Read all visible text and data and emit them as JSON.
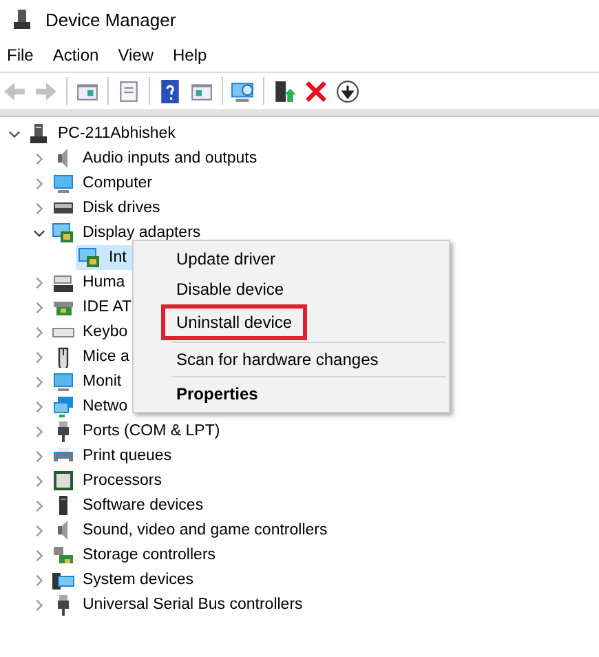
{
  "window": {
    "title": "Device Manager"
  },
  "menu_bar": [
    "File",
    "Action",
    "View",
    "Help"
  ],
  "toolbar": [
    {
      "kind": "back",
      "disabled": true
    },
    {
      "kind": "forward",
      "disabled": true
    },
    {
      "kind": "separator"
    },
    {
      "kind": "tree-pane",
      "disabled": false
    },
    {
      "kind": "separator"
    },
    {
      "kind": "properties",
      "disabled": false
    },
    {
      "kind": "separator"
    },
    {
      "kind": "help",
      "disabled": false
    },
    {
      "kind": "action-pane",
      "disabled": false
    },
    {
      "kind": "separator"
    },
    {
      "kind": "scan",
      "disabled": false
    },
    {
      "kind": "separator"
    },
    {
      "kind": "update",
      "disabled": false
    },
    {
      "kind": "uninstall",
      "disabled": false
    },
    {
      "kind": "disable",
      "disabled": false
    }
  ],
  "tree": {
    "label": "PC-211Abhishek",
    "kind": "pc",
    "expanded": true,
    "children": [
      {
        "label": "Audio inputs and outputs",
        "kind": "speaker",
        "expanded": false
      },
      {
        "label": "Computer",
        "kind": "monitor",
        "expanded": false
      },
      {
        "label": "Disk drives",
        "kind": "disk",
        "expanded": false
      },
      {
        "label": "Display adapters",
        "kind": "adapter",
        "expanded": true,
        "children": [
          {
            "label": "Int",
            "kind": "adapter",
            "selected": true
          }
        ]
      },
      {
        "label": "Huma",
        "kind": "hid",
        "expanded": false
      },
      {
        "label": "IDE AT",
        "kind": "card",
        "expanded": false
      },
      {
        "label": "Keybo",
        "kind": "keyboard",
        "expanded": false
      },
      {
        "label": "Mice a",
        "kind": "mouse",
        "expanded": false
      },
      {
        "label": "Monit",
        "kind": "monitor",
        "expanded": false
      },
      {
        "label": "Netwo",
        "kind": "network",
        "expanded": false
      },
      {
        "label": "Ports (COM & LPT)",
        "kind": "plug",
        "expanded": false
      },
      {
        "label": "Print queues",
        "kind": "printer",
        "expanded": false
      },
      {
        "label": "Processors",
        "kind": "chip",
        "expanded": false
      },
      {
        "label": "Software devices",
        "kind": "tower",
        "expanded": false
      },
      {
        "label": "Sound, video and game controllers",
        "kind": "speaker",
        "expanded": false
      },
      {
        "label": "Storage controllers",
        "kind": "storage",
        "expanded": false
      },
      {
        "label": "System devices",
        "kind": "system",
        "expanded": false
      },
      {
        "label": "Universal Serial Bus controllers",
        "kind": "plug",
        "expanded": false
      }
    ]
  },
  "context_menu": [
    {
      "label": "Update driver",
      "bold": false,
      "outlined": false,
      "separator_before": false
    },
    {
      "label": "Disable device",
      "bold": false,
      "outlined": false,
      "separator_before": false
    },
    {
      "label": "Uninstall device",
      "bold": false,
      "outlined": true,
      "separator_before": false
    },
    {
      "label": "Scan for hardware changes",
      "bold": false,
      "outlined": false,
      "separator_before": true
    },
    {
      "label": "Properties",
      "bold": true,
      "outlined": false,
      "separator_before": true
    }
  ]
}
